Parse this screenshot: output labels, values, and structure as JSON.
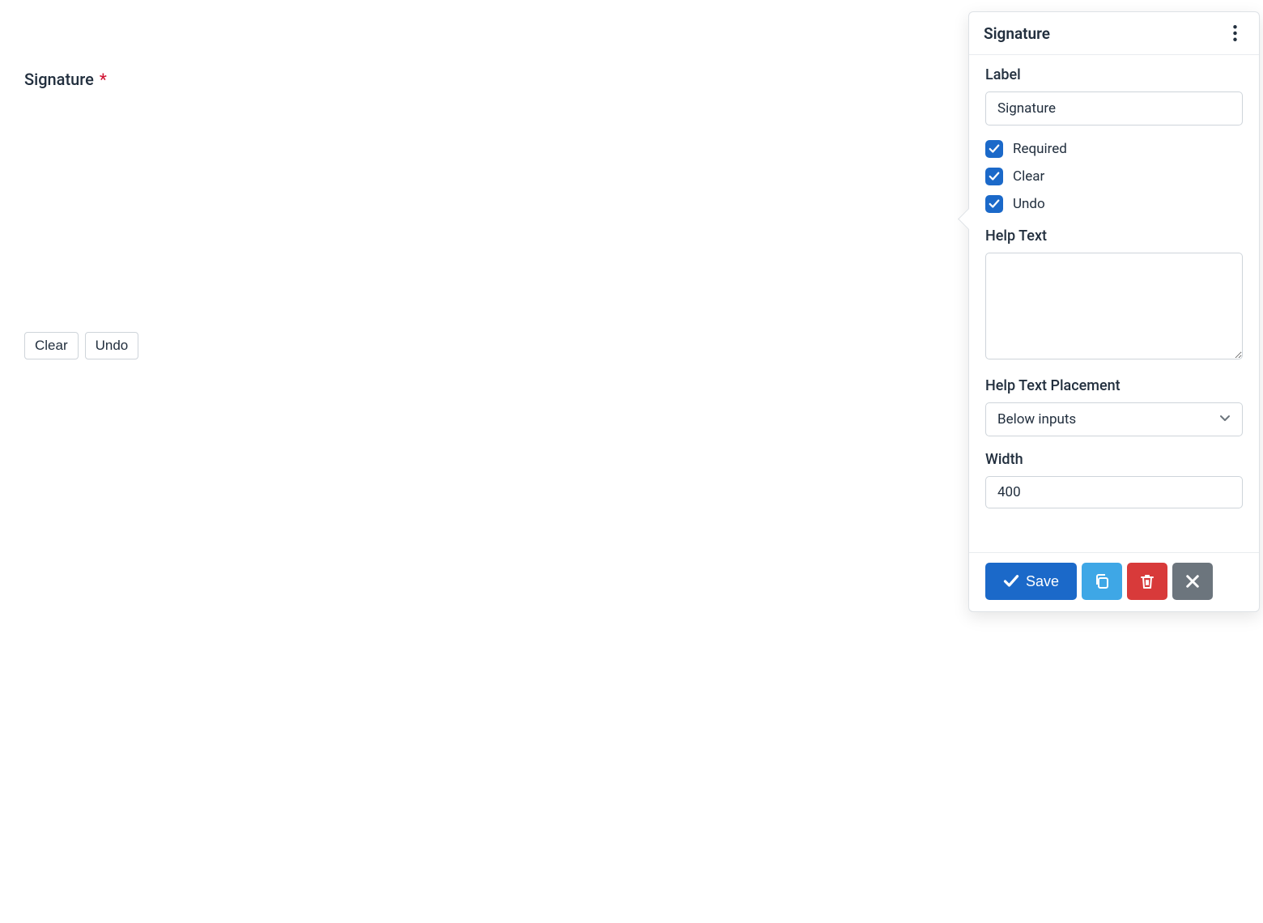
{
  "preview": {
    "label": "Signature",
    "required_marker": "*",
    "clear_btn": "Clear",
    "undo_btn": "Undo"
  },
  "panel": {
    "title": "Signature",
    "label_field": {
      "label": "Label",
      "value": "Signature"
    },
    "checks": {
      "required": "Required",
      "clear": "Clear",
      "undo": "Undo"
    },
    "help_text": {
      "label": "Help Text",
      "value": ""
    },
    "help_placement": {
      "label": "Help Text Placement",
      "value": "Below inputs"
    },
    "width": {
      "label": "Width",
      "value": "400"
    },
    "footer": {
      "save": "Save"
    }
  }
}
